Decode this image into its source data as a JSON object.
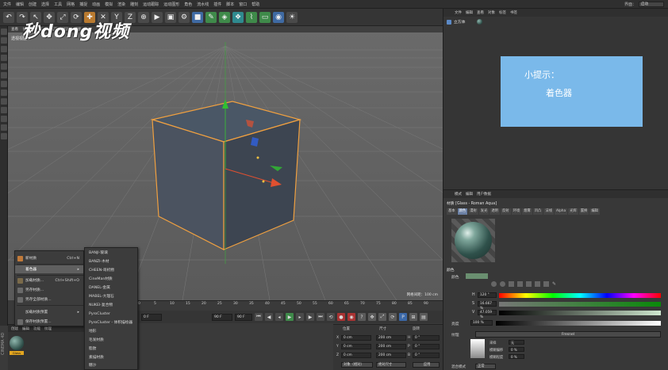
{
  "menubar": {
    "items": [
      "文件",
      "编辑",
      "创建",
      "选择",
      "工具",
      "网格",
      "捕捉",
      "动画",
      "模拟",
      "渲染",
      "雕刻",
      "运动跟踪",
      "运动图形",
      "角色",
      "流水线",
      "插件",
      "脚本",
      "窗口",
      "帮助"
    ],
    "layout_label": "界面：",
    "layout_value": "启动"
  },
  "watermark": "秒dong视频",
  "viewport": {
    "header_items": [
      "查看",
      "摄像机",
      "显示",
      "选项",
      "过滤",
      "面板"
    ],
    "title": "透视视图",
    "grid_readout": "网格间距：100 cm",
    "cube_edge_color": "#f0a040",
    "background_color": "#5c5c5c"
  },
  "timeline": {
    "ticks": [
      "0",
      "5",
      "10",
      "15",
      "20",
      "25",
      "30",
      "35",
      "40",
      "45",
      "50",
      "55",
      "60",
      "65",
      "70",
      "75",
      "80",
      "85",
      "90"
    ],
    "frame_current": "0 F",
    "frame_start": "90 F",
    "frame_end": "90 F"
  },
  "material_manager": {
    "tabs": [
      "创建",
      "编辑",
      "功能",
      "纹理"
    ],
    "material_name": "Glass"
  },
  "context_menu": {
    "items": [
      {
        "label": "新材质",
        "shortcut": "Ctrl+N"
      },
      {
        "label": "着色器",
        "shortcut": ""
      },
      {
        "label": "加载材质...",
        "shortcut": "Ctrl+Shift+O"
      },
      {
        "label": "另存材质...",
        "shortcut": ""
      },
      {
        "label": "另存全部材质...",
        "shortcut": ""
      },
      {
        "label": "加载材质预置",
        "shortcut": ""
      },
      {
        "label": "保存材质预置...",
        "shortcut": ""
      }
    ]
  },
  "submenu": {
    "items": [
      "BANJI-玻璃",
      "BANZI-木材",
      "CHEEN-哥机物",
      "CineMan材质",
      "DANEL-金属",
      "MABEL-大理石",
      "NUKEI-复合物",
      "PyroCluster",
      "PyroCluster - 体积描绘器",
      "地形",
      "毛发材质",
      "脂肪",
      "素描材质",
      "糖沙"
    ]
  },
  "coordinates": {
    "headers": [
      "位置",
      "尺寸",
      "旋转"
    ],
    "rows": [
      {
        "axis": "X",
        "pos": "0 cm",
        "size": "200 cm",
        "rot_axis": "H",
        "rot": "0 °"
      },
      {
        "axis": "Y",
        "pos": "0 cm",
        "size": "200 cm",
        "rot_axis": "P",
        "rot": "0 °"
      },
      {
        "axis": "Z",
        "pos": "0 cm",
        "size": "200 cm",
        "rot_axis": "B",
        "rot": "0 °"
      }
    ],
    "mode_object": "对象（相对）",
    "mode_size": "绝对尺寸",
    "apply": "应用"
  },
  "object_manager": {
    "menu": [
      "文件",
      "编辑",
      "查看",
      "对象",
      "标签",
      "书签"
    ],
    "object_name": "立方体"
  },
  "tip": {
    "title": "小提示：",
    "body": "着色器"
  },
  "attribute_manager": {
    "menu": [
      "模式",
      "编辑",
      "用户数据"
    ],
    "title": "材质 [Glass - Roman Aqua]",
    "tabs": [
      {
        "label": "基本",
        "selected": false
      },
      {
        "label": "颜色",
        "selected": true
      },
      {
        "label": "漫射",
        "selected": false
      },
      {
        "label": "发光",
        "selected": false
      },
      {
        "label": "透明",
        "selected": false
      },
      {
        "label": "反射",
        "selected": false
      },
      {
        "label": "环境",
        "selected": false
      },
      {
        "label": "烟雾",
        "selected": false
      },
      {
        "label": "凹凸",
        "selected": false
      },
      {
        "label": "法线",
        "selected": false
      },
      {
        "label": "Alpha",
        "selected": false
      },
      {
        "label": "光辉",
        "selected": false
      },
      {
        "label": "置换",
        "selected": false
      },
      {
        "label": "编辑",
        "selected": false
      }
    ],
    "section_color": "颜色",
    "color_label": "颜色",
    "h_label": "H",
    "h_value": "120 °",
    "s_label": "S",
    "s_value": "16.667 %",
    "v_label": "V",
    "v_value": "47.059 %",
    "brightness_label": "亮度",
    "brightness_value": "100 %",
    "texture_label": "纹理",
    "texture_shader": "Fresnel",
    "fresnel_rows": [
      {
        "label": "采样",
        "value": "无"
      },
      {
        "label": "模糊偏移",
        "value": "0 %"
      },
      {
        "label": "模糊程度",
        "value": "0 %"
      }
    ],
    "blend_label": "混合模式",
    "blend_value": "正常",
    "swatch_color": "#6a8f70"
  }
}
